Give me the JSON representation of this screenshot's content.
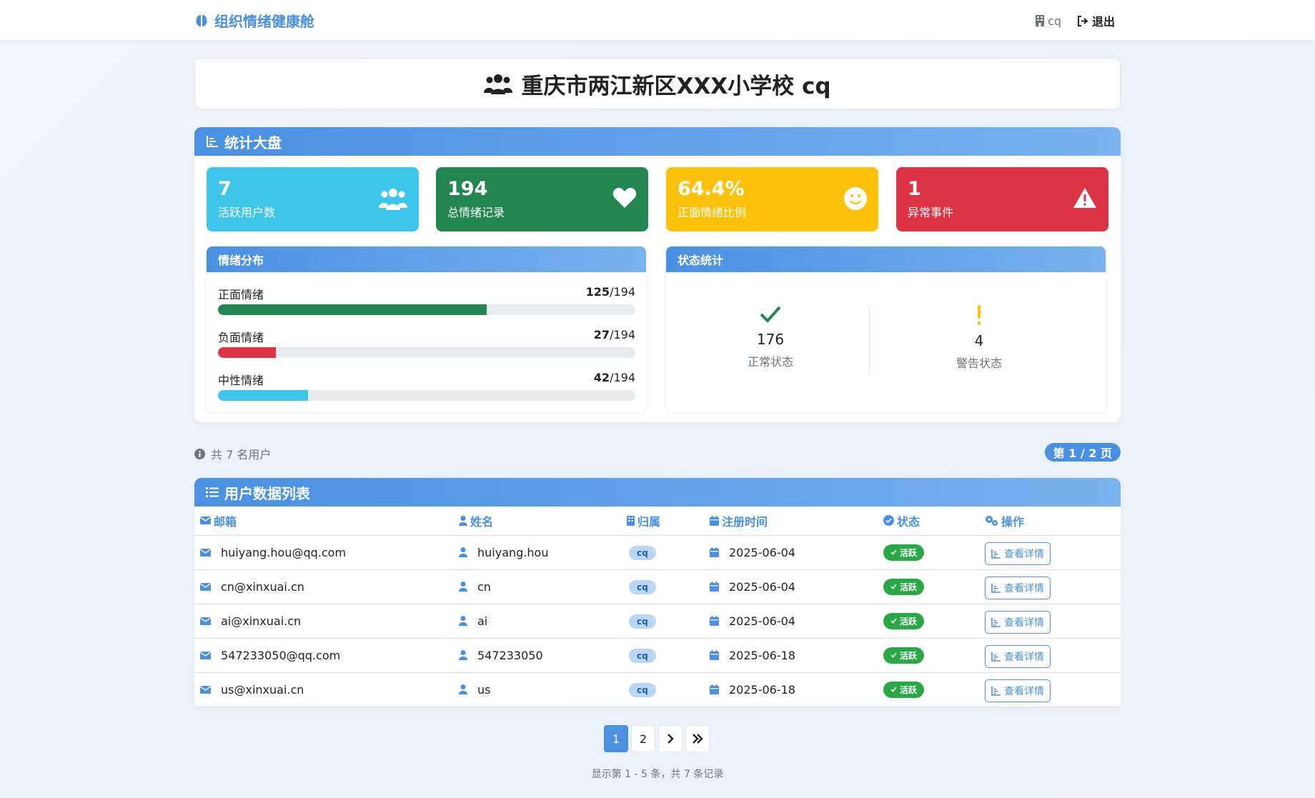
{
  "nav": {
    "brand": "组织情绪健康舱",
    "school_code": "cq",
    "logout": "退出"
  },
  "title": "重庆市两江新区XXX小学校 cq",
  "dashboard": {
    "heading": "统计大盘",
    "cards": [
      {
        "value": "7",
        "label": "活跃用户数",
        "color": "#3ec6ea"
      },
      {
        "value": "194",
        "label": "总情绪记录",
        "color": "#238651"
      },
      {
        "value": "64.4%",
        "label": "正面情绪比例",
        "color": "#fcc10a"
      },
      {
        "value": "1",
        "label": "异常事件",
        "color": "#dc3445"
      }
    ],
    "distribution": {
      "heading": "情绪分布",
      "total": "/194",
      "rows": [
        {
          "label": "正面情绪",
          "count": "125",
          "fraction": 0.644,
          "color": "#238651"
        },
        {
          "label": "负面情绪",
          "count": "27",
          "fraction": 0.139,
          "color": "#dc3445"
        },
        {
          "label": "中性情绪",
          "count": "42",
          "fraction": 0.216,
          "color": "#3ec6ea"
        }
      ]
    },
    "status": {
      "heading": "状态统计",
      "normal": {
        "value": "176",
        "label": "正常状态",
        "color": "#238651"
      },
      "warning": {
        "value": "4",
        "label": "警告状态",
        "color": "#fcc10a"
      }
    }
  },
  "summary": {
    "total_users": "共 7 名用户",
    "page_indicator": "第 1 / 2 页"
  },
  "user_table": {
    "heading": "用户数据列表",
    "columns": [
      "邮箱",
      "姓名",
      "归属",
      "注册时间",
      "状态",
      "操作"
    ],
    "rows": [
      {
        "email": "huiyang.hou@qq.com",
        "name": "huiyang.hou",
        "org": "cq",
        "date": "2025-06-04",
        "status": "活跃",
        "action": "查看详情"
      },
      {
        "email": "cn@xinxuai.cn",
        "name": "cn",
        "org": "cq",
        "date": "2025-06-04",
        "status": "活跃",
        "action": "查看详情"
      },
      {
        "email": "ai@xinxuai.cn",
        "name": "ai",
        "org": "cq",
        "date": "2025-06-04",
        "status": "活跃",
        "action": "查看详情"
      },
      {
        "email": "547233050@qq.com",
        "name": "547233050",
        "org": "cq",
        "date": "2025-06-18",
        "status": "活跃",
        "action": "查看详情"
      },
      {
        "email": "us@xinxuai.cn",
        "name": "us",
        "org": "cq",
        "date": "2025-06-18",
        "status": "活跃",
        "action": "查看详情"
      }
    ]
  },
  "pagination": {
    "pages": [
      "1",
      "2"
    ],
    "next": "›",
    "last": "»",
    "footer": "显示第 1 - 5 条，共 7 条记录"
  }
}
